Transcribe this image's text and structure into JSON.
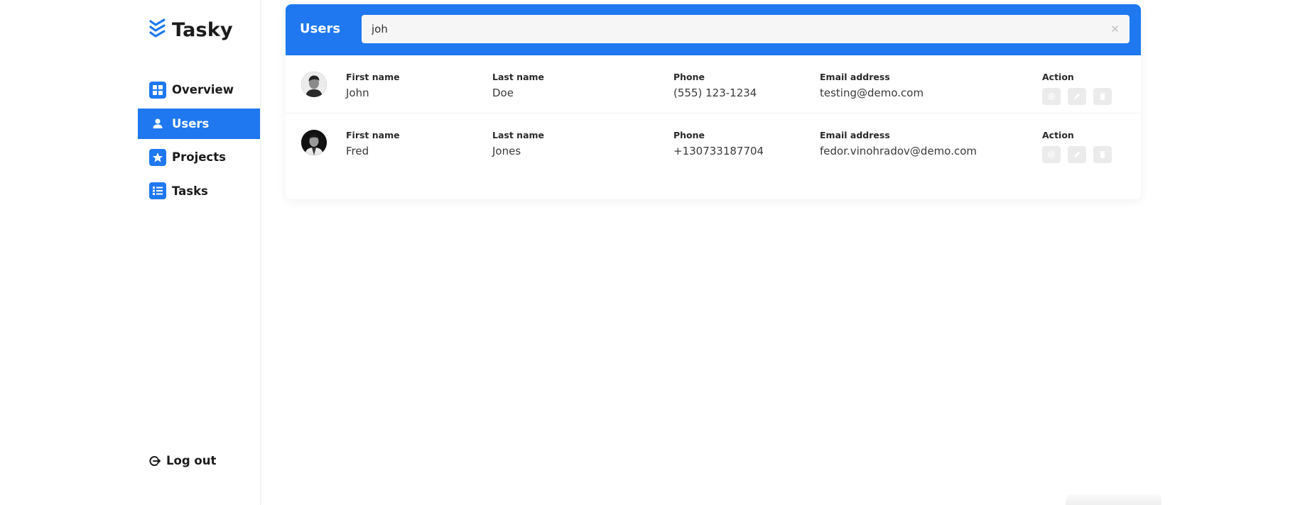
{
  "brand": {
    "name": "Tasky",
    "accent": "#1f78f0"
  },
  "sidebar": {
    "items": [
      {
        "label": "Overview",
        "icon": "grid-icon",
        "active": false
      },
      {
        "label": "Users",
        "icon": "user-icon",
        "active": true
      },
      {
        "label": "Projects",
        "icon": "star-icon",
        "active": false
      },
      {
        "label": "Tasks",
        "icon": "list-icon",
        "active": false
      }
    ],
    "logout_label": "Log out"
  },
  "users_panel": {
    "title": "Users",
    "search": {
      "value": "joh",
      "placeholder": ""
    },
    "columns": {
      "first_name": "First name",
      "last_name": "Last name",
      "phone": "Phone",
      "email": "Email address",
      "action": "Action"
    },
    "rows": [
      {
        "first_name": "John",
        "last_name": "Doe",
        "phone": "(555) 123-1234",
        "email": "testing@demo.com"
      },
      {
        "first_name": "Fred",
        "last_name": "Jones",
        "phone": "+130733187704",
        "email": "fedor.vinohradov@demo.com"
      }
    ],
    "action_icons": [
      "gear-icon",
      "pencil-icon",
      "trash-icon"
    ]
  }
}
